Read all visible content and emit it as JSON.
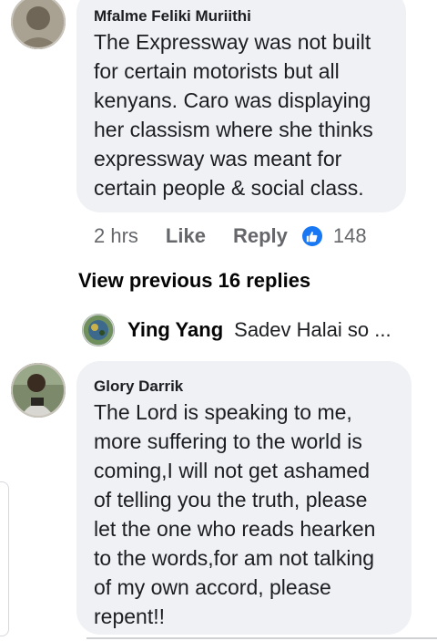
{
  "comments": [
    {
      "author": "Mfalme Feliki Muriithi",
      "text": "The Expressway was not built\nfor certain motorists but all\nkenyans. Caro was displaying\nher classism where she thinks\nexpressway was meant for\ncertain people & social class."
    },
    {
      "author": "Glory Darrik",
      "text": "The Lord is speaking to me,\nmore suffering to the world is\ncoming,I will not get ashamed\nof telling you the truth, please\nlet the one who reads hearken\nto the words,for am not talking\nof my own accord, please\nrepent!!"
    }
  ],
  "actions": {
    "time": "2 hrs",
    "like_label": "Like",
    "reply_label": "Reply",
    "reaction_icon": "like-thumb-icon",
    "reaction_count": "148"
  },
  "view_previous_label": "View previous 16 replies",
  "reply_preview": {
    "name": "Ying Yang",
    "text": "Sadev Halai so ..."
  },
  "colors": {
    "bubble_bg": "#eff1f4",
    "secondary_text": "#65676b",
    "like_blue": "#1877f2"
  }
}
